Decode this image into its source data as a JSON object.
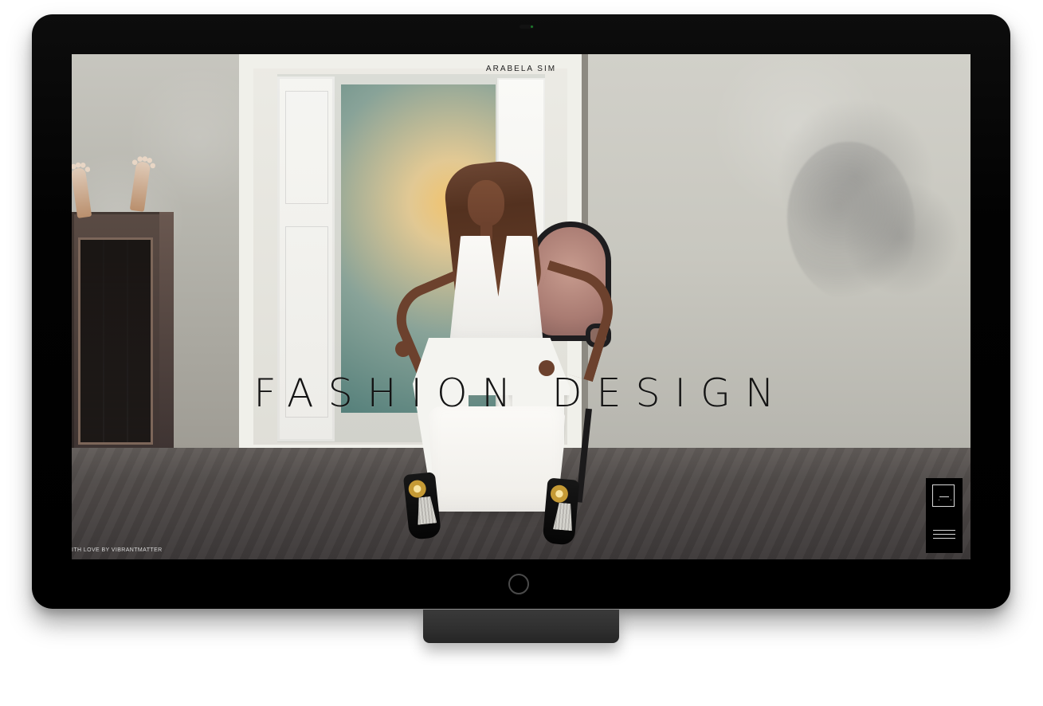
{
  "site": {
    "brand": "ARABELA SIM",
    "hero_title": "FASHION DESIGN",
    "credit": "ITH LOVE BY VIBRANTMATTER"
  },
  "icons": {
    "logo": "triangle-logo-icon",
    "menu": "hamburger-menu-icon"
  },
  "colors": {
    "frame": "#000000",
    "panel": "#000000",
    "text_dark": "#141414",
    "text_light": "#d8d8d8"
  }
}
